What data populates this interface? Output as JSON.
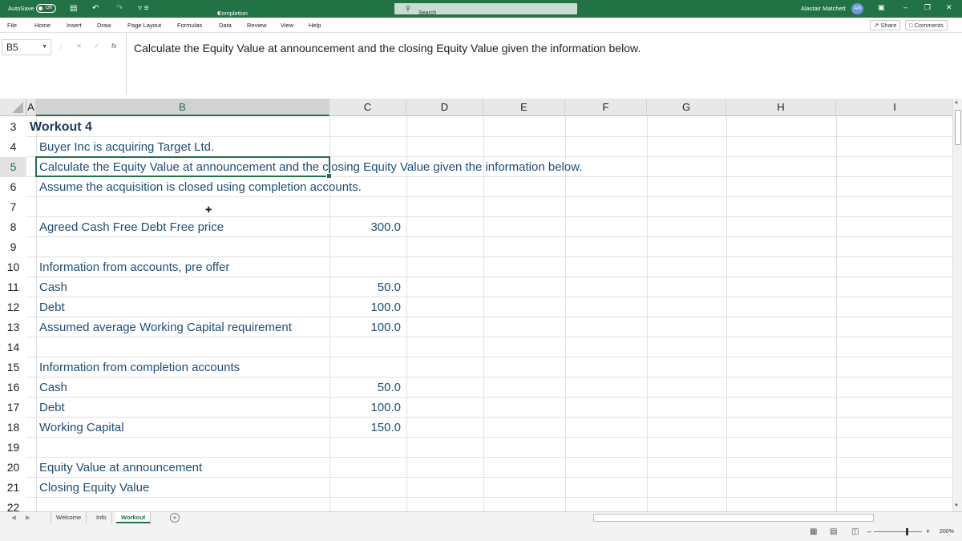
{
  "titlebar": {
    "autosave_label": "AutoSave",
    "autosave_state": "Off",
    "doc_title": "Completion Mechanisms Workout Full Instructor",
    "doc_title_caret": "▾",
    "search_placeholder": "Search",
    "user_name": "Alastair Matchett",
    "user_initials": "AM",
    "color": "#217346"
  },
  "ribbon": {
    "tabs": [
      "File",
      "Home",
      "Insert",
      "Draw",
      "Page Layout",
      "Formulas",
      "Data",
      "Review",
      "View",
      "Help"
    ],
    "share_label": "Share",
    "comments_label": "Comments"
  },
  "formula_bar": {
    "name_box": "B5",
    "fx_symbol": "fx",
    "content": "Calculate the Equity Value at announcement and the closing Equity Value given the information below."
  },
  "grid": {
    "columns": [
      "A",
      "B",
      "C",
      "D",
      "E",
      "F",
      "G",
      "H",
      "I"
    ],
    "rows": [
      "3",
      "4",
      "5",
      "6",
      "7",
      "8",
      "9",
      "10",
      "11",
      "12",
      "13",
      "14",
      "15",
      "16",
      "17",
      "18",
      "19",
      "20",
      "21",
      "22"
    ],
    "cells": {
      "A3": "Workout 4",
      "B4": "Buyer Inc is acquiring Target Ltd.",
      "B5": "Calculate the Equity Value at announcement and the closing Equity Value given the information below.",
      "B6": "Assume the acquisition is closed using completion accounts.",
      "B8": "Agreed Cash Free Debt Free price",
      "C8": "300.0",
      "B10": "Information from accounts, pre offer",
      "B11": "Cash",
      "C11": "50.0",
      "B12": "Debt",
      "C12": "100.0",
      "B13": "Assumed average Working Capital requirement",
      "C13": "100.0",
      "B15": "Information from completion accounts",
      "B16": "Cash",
      "C16": "50.0",
      "B17": "Debt",
      "C17": "100.0",
      "B18": "Working Capital",
      "C18": "150.0",
      "B20": "Equity Value at announcement",
      "B21": "Closing Equity Value"
    },
    "text_color": "#1f4e79",
    "selected_cell": "B5"
  },
  "sheets": {
    "tabs": [
      "Welcome",
      "Info",
      "Workout"
    ],
    "active": "Workout"
  },
  "status": {
    "zoom": "200%"
  }
}
